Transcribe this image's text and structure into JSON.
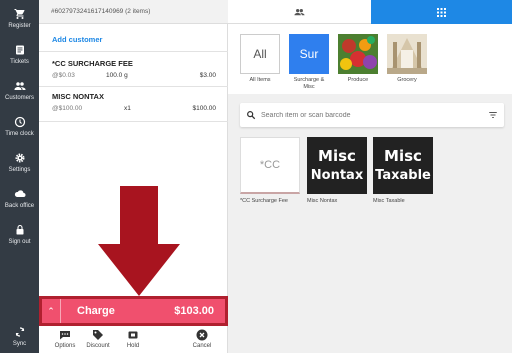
{
  "nav": {
    "items": [
      {
        "label": "Register",
        "icon": "cart-icon"
      },
      {
        "label": "Tickets",
        "icon": "receipt-icon"
      },
      {
        "label": "Customers",
        "icon": "people-icon"
      },
      {
        "label": "Time clock",
        "icon": "clock-icon"
      },
      {
        "label": "Settings",
        "icon": "gear-icon"
      },
      {
        "label": "Back office",
        "icon": "cloud-icon"
      },
      {
        "label": "Sign out",
        "icon": "lock-icon"
      }
    ],
    "sync": {
      "label": "Sync",
      "icon": "sync-icon"
    }
  },
  "ticket": {
    "header": "#6027973241617140969 (2 items)",
    "add_customer": "Add customer",
    "line_items": [
      {
        "name": "*CC SURCHARGE FEE",
        "unit_price": "@$0.03",
        "qty": "100.0 g",
        "amount": "$3.00"
      },
      {
        "name": "MISC NONTAX",
        "unit_price": "@$100.00",
        "qty": "x1",
        "amount": "$100.00"
      }
    ]
  },
  "charge": {
    "label": "Charge",
    "amount": "$103.00",
    "color": "#f0506e",
    "border_color": "#b0202f"
  },
  "toolbar": {
    "options": "Options",
    "discount": "Discount",
    "hold": "Hold",
    "cancel": "Cancel"
  },
  "tabs": {
    "active": "item-grid",
    "accent": "#1e88e5"
  },
  "categories": [
    {
      "tile": "All",
      "label": "All Items",
      "color": "#ffffff"
    },
    {
      "tile": "Sur",
      "label": "Surcharge & Misc",
      "color": "#2f7fee"
    },
    {
      "tile": "",
      "label": "Produce",
      "color": "#c0392b"
    },
    {
      "tile": "",
      "label": "Grocery",
      "color": "#c9b99a"
    }
  ],
  "search": {
    "placeholder": "Search item or scan barcode"
  },
  "products": [
    {
      "tile": "*CC",
      "label": "*CC Surcharge Fee"
    },
    {
      "tile_line1": "Misc",
      "tile_line2": "Nontax",
      "label": "Misc Nontax"
    },
    {
      "tile_line1": "Misc",
      "tile_line2": "Taxable",
      "label": "Misc Taxable"
    }
  ],
  "annotation": {
    "arrow_color": "#a8141f"
  }
}
